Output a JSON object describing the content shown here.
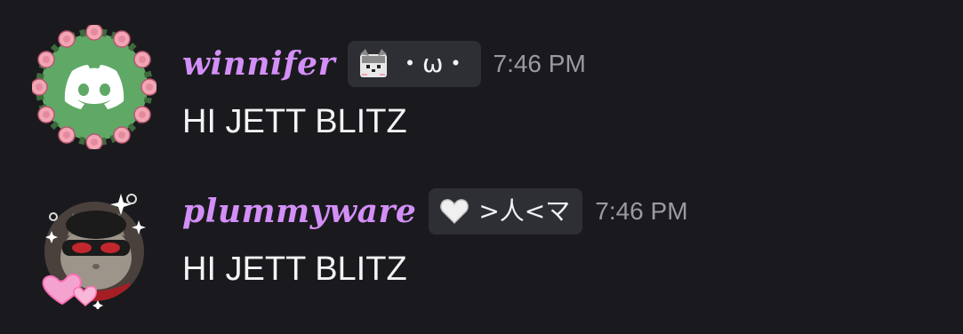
{
  "messages": [
    {
      "username": "winnifer",
      "tag": {
        "icon": "cat-face-icon",
        "text": "・ω・"
      },
      "timestamp": "7:46 PM",
      "content": "HI JETT BLITZ",
      "avatar": {
        "description_icon": "discord-logo-icon",
        "background_color": "#5fa866",
        "frame": "pink-rose-wreath"
      }
    },
    {
      "username": "plummyware",
      "tag": {
        "icon": "heart-icon",
        "text": ">人<マ"
      },
      "timestamp": "7:46 PM",
      "content": "HI JETT BLITZ",
      "avatar": {
        "description_icon": "masked-cat-icon",
        "frame": "pink-heart-sparkle"
      }
    }
  ],
  "colors": {
    "background": "#1a1a1e",
    "username": "#d38ff7",
    "tag_background": "#2e2f34",
    "timestamp": "#9a9ba1",
    "text": "#f2f3f5"
  }
}
